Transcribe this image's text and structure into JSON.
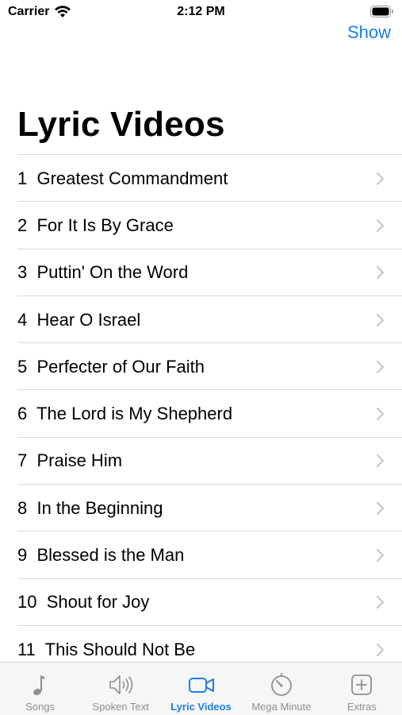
{
  "status_bar": {
    "carrier": "Carrier",
    "time": "2:12 PM",
    "wifi_icon": "wifi-icon",
    "battery_icon": "battery-icon"
  },
  "nav": {
    "show_label": "Show"
  },
  "page": {
    "title": "Lyric Videos"
  },
  "videos": [
    {
      "label": "1  Greatest Commandment"
    },
    {
      "label": "2  For It Is By Grace"
    },
    {
      "label": "3  Puttin' On the Word"
    },
    {
      "label": "4  Hear O Israel"
    },
    {
      "label": "5  Perfecter of Our Faith"
    },
    {
      "label": "6  The Lord is My Shepherd"
    },
    {
      "label": "7  Praise Him"
    },
    {
      "label": "8  In the Beginning"
    },
    {
      "label": "9  Blessed is the Man"
    },
    {
      "label": "10  Shout for Joy"
    },
    {
      "label": "11  This Should Not Be"
    }
  ],
  "tab_bar": {
    "tabs": [
      {
        "label": "Songs",
        "icon": "music-note-icon",
        "active": false
      },
      {
        "label": "Spoken Text",
        "icon": "speaker-icon",
        "active": false
      },
      {
        "label": "Lyric Videos",
        "icon": "video-camera-icon",
        "active": true
      },
      {
        "label": "Mega Minute",
        "icon": "timer-icon",
        "active": false
      },
      {
        "label": "Extras",
        "icon": "plus-square-icon",
        "active": false
      }
    ]
  },
  "colors": {
    "accent": "#1a7df0",
    "inactive_tab": "#8e8e93",
    "separator": "#d9d9d9",
    "tab_bar_bg": "#f6f6f6"
  }
}
